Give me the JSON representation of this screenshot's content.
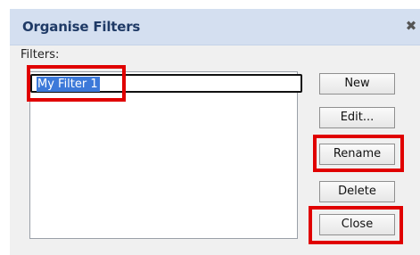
{
  "dialog": {
    "title": "Organise Filters",
    "close_glyph": "✖"
  },
  "filters": {
    "label": "Filters:",
    "editing_value": "My Filter 1"
  },
  "buttons": {
    "new": "New",
    "edit": "Edit...",
    "rename": "Rename",
    "delete": "Delete",
    "close": "Close"
  },
  "highlights": {
    "color": "#e00000",
    "targets": [
      "filter-name-field",
      "rename-button",
      "close-button"
    ]
  },
  "colors": {
    "titlebar": "#d4dff0",
    "title_text": "#1f3a66",
    "panel": "#f0f0f0",
    "selection": "#3c79d9"
  }
}
